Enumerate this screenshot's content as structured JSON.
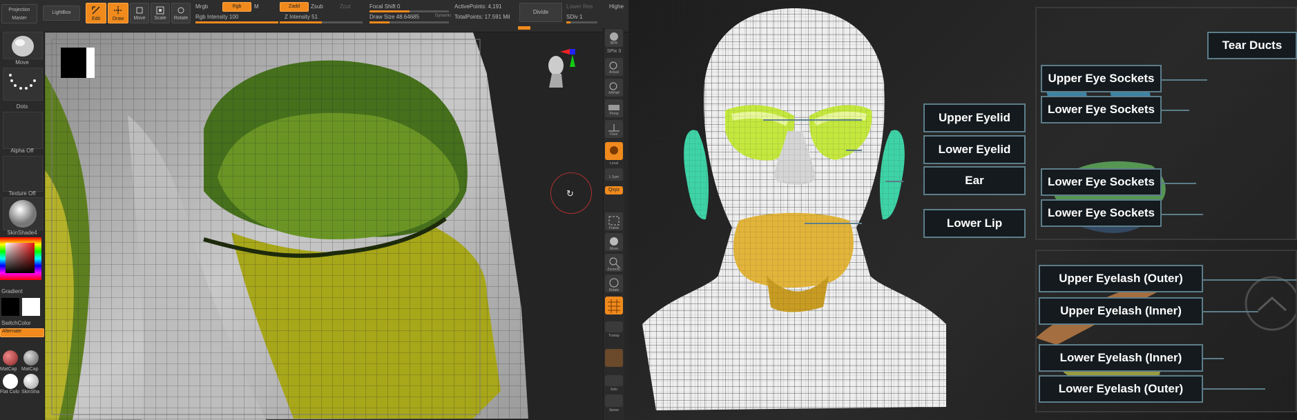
{
  "topbar": {
    "projection_master": "Projection Master",
    "lightbox": "LightBox",
    "edit": "Edit",
    "draw": "Draw",
    "move": "Move",
    "scale": "Scale",
    "rotate": "Rotate",
    "mrgb": "Mrgb",
    "rgb": "Rgb",
    "m": "M",
    "rgb_intensity": "Rgb Intensity 100",
    "zadd": "Zadd",
    "zsub": "Zsub",
    "zcut": "Zcut",
    "z_intensity": "Z Intensity 51",
    "focal_shift": "Focal Shift 0",
    "draw_size": "Draw Size 48.64685",
    "dynamic": "Dynamic",
    "active_points": "ActivePoints: 4,191",
    "total_points": "TotalPoints: 17.591 Mil",
    "divide": "Divide",
    "lower_res": "Lower Res",
    "sdiv": "SDiv 1",
    "higher": "Highe"
  },
  "progress": {
    "rgb_intensity": 1.0,
    "z_intensity": 0.51,
    "focal_shift": 0.5,
    "draw_size": 0.25
  },
  "left_shelf": {
    "brush": "Move",
    "stroke": "Dots",
    "alpha": "Alpha Off",
    "texture": "Texture Off",
    "material": "SkinShade4",
    "gradient": "Gradient",
    "switch_color": "SwitchColor",
    "alternate": "Alternate",
    "matcap1": "MatCap",
    "matcap2": "MatCap",
    "flat_color": "Flat Colo",
    "skinsha": "SkinSha"
  },
  "right_shelf": {
    "bpr": "BPR",
    "spix": "SPix 3",
    "actual": "Actual",
    "aahalf": "AAHalf",
    "persp": "Persp",
    "floor": "Floor",
    "local": "Local",
    "lsym": "L.Sym",
    "qxyz": "Qxyz",
    "frame": "Frame",
    "move": "Move",
    "zoom3d": "Zoom3D",
    "rotate": "Rotate",
    "linefill": "Line Fill",
    "transp": "Transp",
    "solo": "Solo",
    "xpose": "Xpose"
  },
  "callouts": {
    "upper_eyelid": "Upper Eyelid",
    "lower_eyelid": "Lower Eyelid",
    "ear": "Ear",
    "lower_lip": "Lower Lip",
    "tear_ducts": "Tear Ducts",
    "upper_eye_sockets": "Upper Eye Sockets",
    "lower_eye_sockets_1": "Lower Eye Sockets",
    "lower_eye_sockets_2": "Lower Eye Sockets",
    "lower_eye_sockets_3": "Lower Eye Sockets",
    "upper_eyelash_outer": "Upper Eyelash (Outer)",
    "upper_eyelash_inner": "Upper Eyelash (Inner)",
    "lower_eyelash_inner": "Lower Eyelash (Inner)",
    "lower_eyelash_outer": "Lower Eyelash (Outer)"
  },
  "colors": {
    "accent": "#f08a1c",
    "callout_border": "#5d7e8a",
    "eyelid_green": "#b9df3a",
    "socket_blue": "#49b6e6",
    "ear_teal": "#3ed3a6",
    "lip_yellow": "#e2b43a"
  }
}
